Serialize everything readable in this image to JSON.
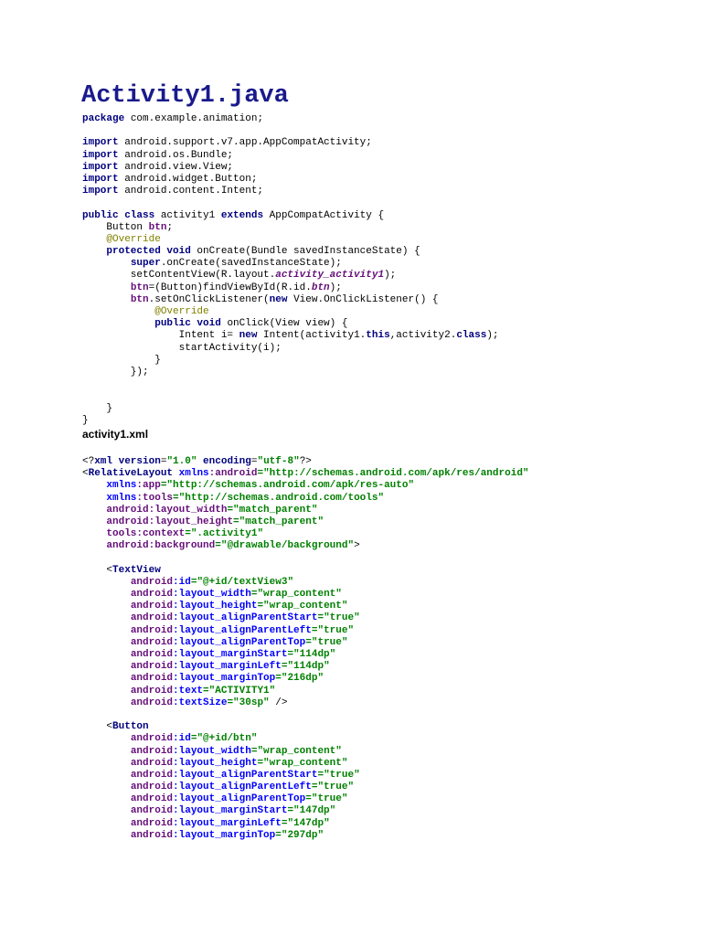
{
  "java_title": "Activity1.java",
  "xml_title": "activity1.xml",
  "java": [
    [
      [
        "package",
        "kw"
      ],
      [
        " com.example.animation;",
        "pl"
      ]
    ],
    [],
    [
      [
        "import",
        "kw"
      ],
      [
        " android.support.v7.app.AppCompatActivity;",
        "pl"
      ]
    ],
    [
      [
        "import",
        "kw"
      ],
      [
        " android.os.Bundle;",
        "pl"
      ]
    ],
    [
      [
        "import",
        "kw"
      ],
      [
        " android.view.View;",
        "pl"
      ]
    ],
    [
      [
        "import",
        "kw"
      ],
      [
        " android.widget.Button;",
        "pl"
      ]
    ],
    [
      [
        "import",
        "kw"
      ],
      [
        " android.content.Intent;",
        "pl"
      ]
    ],
    [],
    [
      [
        "public class",
        "kw"
      ],
      [
        " activity1 ",
        "pl"
      ],
      [
        "extends",
        "kw"
      ],
      [
        " AppCompatActivity {",
        "pl"
      ]
    ],
    [
      [
        "    Button ",
        "pl"
      ],
      [
        "btn",
        "fld"
      ],
      [
        ";",
        "pl"
      ]
    ],
    [
      [
        "    ",
        "pl"
      ],
      [
        "@Override",
        "ann"
      ]
    ],
    [
      [
        "    ",
        "pl"
      ],
      [
        "protected void",
        "kw"
      ],
      [
        " onCreate(Bundle savedInstanceState) {",
        "pl"
      ]
    ],
    [
      [
        "        ",
        "pl"
      ],
      [
        "super",
        "kw"
      ],
      [
        ".onCreate(savedInstanceState);",
        "pl"
      ]
    ],
    [
      [
        "        setContentView(R.layout.",
        "pl"
      ],
      [
        "activity_activity1",
        "fi"
      ],
      [
        ");",
        "pl"
      ]
    ],
    [
      [
        "        ",
        "pl"
      ],
      [
        "btn",
        "fld"
      ],
      [
        "=(Button)findViewById(R.id.",
        "pl"
      ],
      [
        "btn",
        "fi"
      ],
      [
        ");",
        "pl"
      ]
    ],
    [
      [
        "        ",
        "pl"
      ],
      [
        "btn",
        "fld"
      ],
      [
        ".setOnClickListener(",
        "pl"
      ],
      [
        "new",
        "kw"
      ],
      [
        " View.OnClickListener() {",
        "pl"
      ]
    ],
    [
      [
        "            ",
        "pl"
      ],
      [
        "@Override",
        "ann"
      ]
    ],
    [
      [
        "            ",
        "pl"
      ],
      [
        "public void",
        "kw"
      ],
      [
        " onClick(View view) {",
        "pl"
      ]
    ],
    [
      [
        "                Intent i= ",
        "pl"
      ],
      [
        "new",
        "kw"
      ],
      [
        " Intent(activity1.",
        "pl"
      ],
      [
        "this",
        "kw"
      ],
      [
        ",activity2.",
        "pl"
      ],
      [
        "class",
        "kw"
      ],
      [
        ");",
        "pl"
      ]
    ],
    [
      [
        "                startActivity(i);",
        "pl"
      ]
    ],
    [
      [
        "            }",
        "pl"
      ]
    ],
    [
      [
        "        });",
        "pl"
      ]
    ],
    [],
    [],
    [
      [
        "    }",
        "pl"
      ]
    ],
    [
      [
        "}",
        "pl"
      ]
    ]
  ],
  "xml": [
    [
      [
        "<?",
        "pl"
      ],
      [
        "xml version",
        "tag"
      ],
      [
        "=",
        "pl"
      ],
      [
        "\"1.0\"",
        "str"
      ],
      [
        " encoding",
        "tag"
      ],
      [
        "=",
        "pl"
      ],
      [
        "\"utf-8\"",
        "str"
      ],
      [
        "?>",
        "pl"
      ]
    ],
    [
      [
        "<",
        "pl"
      ],
      [
        "RelativeLayout ",
        "tag"
      ],
      [
        "xmlns",
        "att"
      ],
      [
        ":android",
        "ns"
      ],
      [
        "=\"http://schemas.android.com/apk/res/android\"",
        "str"
      ]
    ],
    [
      [
        "    ",
        "pl"
      ],
      [
        "xmlns",
        "att"
      ],
      [
        ":app",
        "ns"
      ],
      [
        "=\"http://schemas.android.com/apk/res-auto\"",
        "str"
      ]
    ],
    [
      [
        "    ",
        "pl"
      ],
      [
        "xmlns",
        "att"
      ],
      [
        ":tools",
        "ns"
      ],
      [
        "=\"http://schemas.android.com/tools\"",
        "str"
      ]
    ],
    [
      [
        "    ",
        "pl"
      ],
      [
        "android",
        "ns"
      ],
      [
        ":layout_width",
        "ns"
      ],
      [
        "=\"match_parent\"",
        "str"
      ]
    ],
    [
      [
        "    ",
        "pl"
      ],
      [
        "android",
        "ns"
      ],
      [
        ":layout_height",
        "ns"
      ],
      [
        "=\"match_parent\"",
        "str"
      ]
    ],
    [
      [
        "    ",
        "pl"
      ],
      [
        "tools",
        "ns"
      ],
      [
        ":context",
        "ns"
      ],
      [
        "=\".activity1\"",
        "str"
      ]
    ],
    [
      [
        "    ",
        "pl"
      ],
      [
        "android",
        "ns"
      ],
      [
        ":background",
        "ns"
      ],
      [
        "=\"@drawable/background\"",
        "str"
      ],
      [
        ">",
        "pl"
      ]
    ],
    [],
    [
      [
        "    <",
        "pl"
      ],
      [
        "TextView",
        "tag"
      ]
    ],
    [
      [
        "        ",
        "pl"
      ],
      [
        "android",
        "ns"
      ],
      [
        ":id",
        "att"
      ],
      [
        "=\"@+id/textView3\"",
        "str"
      ]
    ],
    [
      [
        "        ",
        "pl"
      ],
      [
        "android",
        "ns"
      ],
      [
        ":layout_width",
        "att"
      ],
      [
        "=\"wrap_content\"",
        "str"
      ]
    ],
    [
      [
        "        ",
        "pl"
      ],
      [
        "android",
        "ns"
      ],
      [
        ":layout_height",
        "att"
      ],
      [
        "=\"wrap_content\"",
        "str"
      ]
    ],
    [
      [
        "        ",
        "pl"
      ],
      [
        "android",
        "ns"
      ],
      [
        ":layout_alignParentStart",
        "att"
      ],
      [
        "=\"true\"",
        "str"
      ]
    ],
    [
      [
        "        ",
        "pl"
      ],
      [
        "android",
        "ns"
      ],
      [
        ":layout_alignParentLeft",
        "att"
      ],
      [
        "=\"true\"",
        "str"
      ]
    ],
    [
      [
        "        ",
        "pl"
      ],
      [
        "android",
        "ns"
      ],
      [
        ":layout_alignParentTop",
        "att"
      ],
      [
        "=\"true\"",
        "str"
      ]
    ],
    [
      [
        "        ",
        "pl"
      ],
      [
        "android",
        "ns"
      ],
      [
        ":layout_marginStart",
        "att"
      ],
      [
        "=\"114dp\"",
        "str"
      ]
    ],
    [
      [
        "        ",
        "pl"
      ],
      [
        "android",
        "ns"
      ],
      [
        ":layout_marginLeft",
        "att"
      ],
      [
        "=\"114dp\"",
        "str"
      ]
    ],
    [
      [
        "        ",
        "pl"
      ],
      [
        "android",
        "ns"
      ],
      [
        ":layout_marginTop",
        "att"
      ],
      [
        "=\"216dp\"",
        "str"
      ]
    ],
    [
      [
        "        ",
        "pl"
      ],
      [
        "android",
        "ns"
      ],
      [
        ":text",
        "att"
      ],
      [
        "=\"ACTIVITY1\"",
        "str"
      ]
    ],
    [
      [
        "        ",
        "pl"
      ],
      [
        "android",
        "ns"
      ],
      [
        ":textSize",
        "att"
      ],
      [
        "=\"30sp\"",
        "str"
      ],
      [
        " />",
        "pl"
      ]
    ],
    [],
    [
      [
        "    <",
        "pl"
      ],
      [
        "Button",
        "tag"
      ]
    ],
    [
      [
        "        ",
        "pl"
      ],
      [
        "android",
        "ns"
      ],
      [
        ":id",
        "att"
      ],
      [
        "=\"@+id/btn\"",
        "str"
      ]
    ],
    [
      [
        "        ",
        "pl"
      ],
      [
        "android",
        "ns"
      ],
      [
        ":layout_width",
        "att"
      ],
      [
        "=\"wrap_content\"",
        "str"
      ]
    ],
    [
      [
        "        ",
        "pl"
      ],
      [
        "android",
        "ns"
      ],
      [
        ":layout_height",
        "att"
      ],
      [
        "=\"wrap_content\"",
        "str"
      ]
    ],
    [
      [
        "        ",
        "pl"
      ],
      [
        "android",
        "ns"
      ],
      [
        ":layout_alignParentStart",
        "att"
      ],
      [
        "=\"true\"",
        "str"
      ]
    ],
    [
      [
        "        ",
        "pl"
      ],
      [
        "android",
        "ns"
      ],
      [
        ":layout_alignParentLeft",
        "att"
      ],
      [
        "=\"true\"",
        "str"
      ]
    ],
    [
      [
        "        ",
        "pl"
      ],
      [
        "android",
        "ns"
      ],
      [
        ":layout_alignParentTop",
        "att"
      ],
      [
        "=\"true\"",
        "str"
      ]
    ],
    [
      [
        "        ",
        "pl"
      ],
      [
        "android",
        "ns"
      ],
      [
        ":layout_marginStart",
        "att"
      ],
      [
        "=\"147dp\"",
        "str"
      ]
    ],
    [
      [
        "        ",
        "pl"
      ],
      [
        "android",
        "ns"
      ],
      [
        ":layout_marginLeft",
        "att"
      ],
      [
        "=\"147dp\"",
        "str"
      ]
    ],
    [
      [
        "        ",
        "pl"
      ],
      [
        "android",
        "ns"
      ],
      [
        ":layout_marginTop",
        "att"
      ],
      [
        "=\"297dp\"",
        "str"
      ]
    ]
  ]
}
